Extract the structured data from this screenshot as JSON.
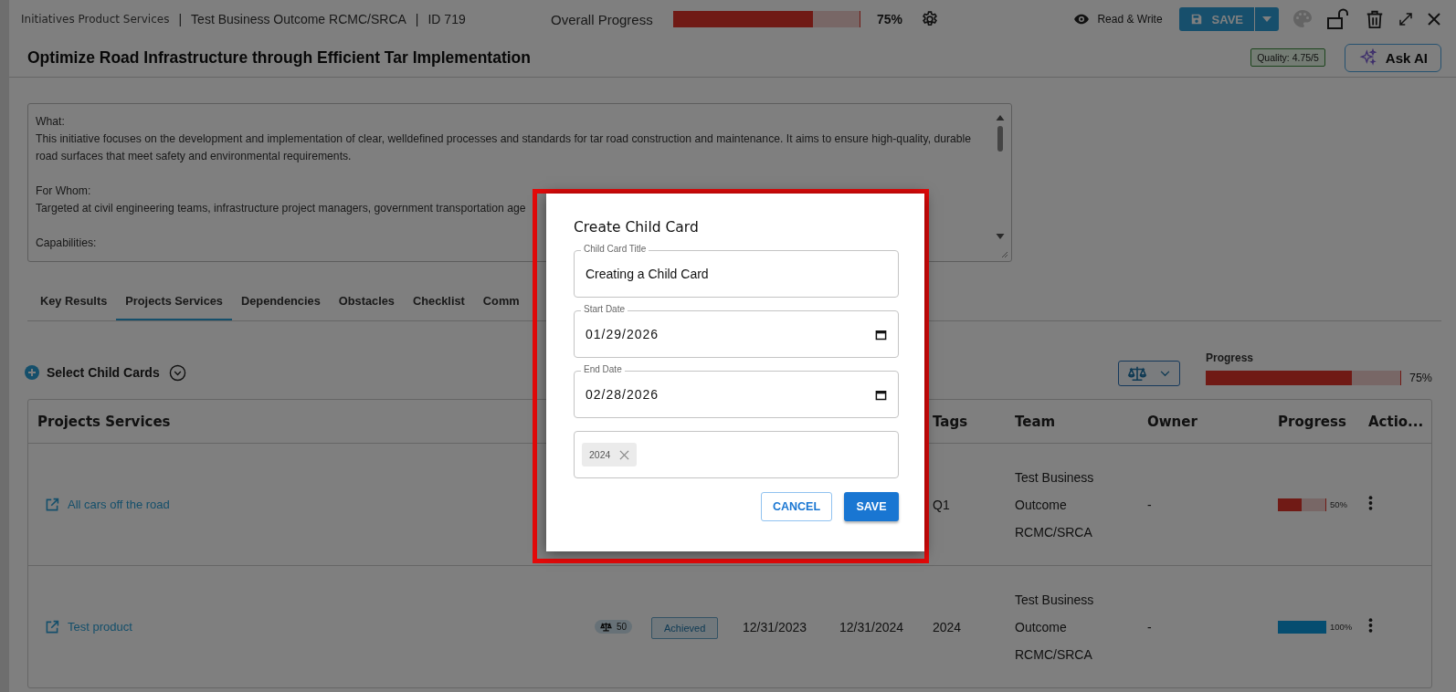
{
  "header": {
    "breadcrumb_separator": "|",
    "breadcrumbs": [
      "Initiatives Product Services",
      "Test Business Outcome RCMC/SRCA",
      "ID 719"
    ],
    "overall_progress": {
      "label": "Overall Progress",
      "level": 0.75,
      "reading": "75%"
    },
    "access": "Read & Write",
    "save_button": "SAVE",
    "title": "Optimize Road Infrastructure through Efficient Tar Implementation",
    "quality": "Quality: 4.75/5",
    "ask_ai": "Ask AI"
  },
  "description": [
    {
      "heading": "What:",
      "text": "This initiative focuses on the development and implementation of clear, welldefined processes and standards for tar road construction and maintenance. It aims to ensure high-quality, durable road surfaces that meet safety and environmental requirements."
    },
    {
      "heading": "For Whom:",
      "text": "Targeted at civil engineering teams, infrastructure project managers, government transportation age"
    },
    {
      "heading": "Capabilities:"
    }
  ],
  "tabs": [
    {
      "label": "Key Results",
      "selected": false
    },
    {
      "label": "Projects Services",
      "selected": true
    },
    {
      "label": "Dependencies",
      "selected": false
    },
    {
      "label": "Obstacles",
      "selected": false
    },
    {
      "label": "Checklist",
      "selected": false
    },
    {
      "label": "Comm",
      "selected": false
    }
  ],
  "select_child_cards": "Select Child Cards",
  "progress_summary": {
    "label": "Progress",
    "level": 0.75,
    "reading": "75%"
  },
  "table": {
    "title": "Projects Services",
    "columns": [
      "Tags",
      "Team",
      "Owner",
      "Progress",
      "Actio..."
    ],
    "rows": [
      {
        "name": "All cars off the road",
        "tags": "Q1",
        "team": [
          "Test Business",
          "Outcome",
          "RCMC/SRCA"
        ],
        "owner": "-",
        "progress": {
          "level": 0.5,
          "reading": "50%"
        }
      },
      {
        "name": "Test product",
        "weight": "50",
        "status": "Achieved",
        "start_date": "12/31/2023",
        "end_date": "12/31/2024",
        "tags": "2024",
        "team": [
          "Test Business",
          "Outcome",
          "RCMC/SRCA"
        ],
        "owner": "-",
        "progress": {
          "level": 1,
          "reading": "100%"
        }
      }
    ]
  },
  "dialog": {
    "title": "Create Child Card",
    "fields": [
      {
        "kind": "text",
        "label": "Child Card Title",
        "value": "Creating a Child Card"
      },
      {
        "kind": "date",
        "label": "Start Date",
        "value": "01/29/2026"
      },
      {
        "kind": "date",
        "label": "End Date",
        "value": "02/28/2026"
      }
    ],
    "chips": [
      "2024"
    ],
    "buttons": [
      {
        "kind": "outlined",
        "label": "CANCEL"
      },
      {
        "kind": "primary",
        "label": "SAVE"
      }
    ]
  }
}
